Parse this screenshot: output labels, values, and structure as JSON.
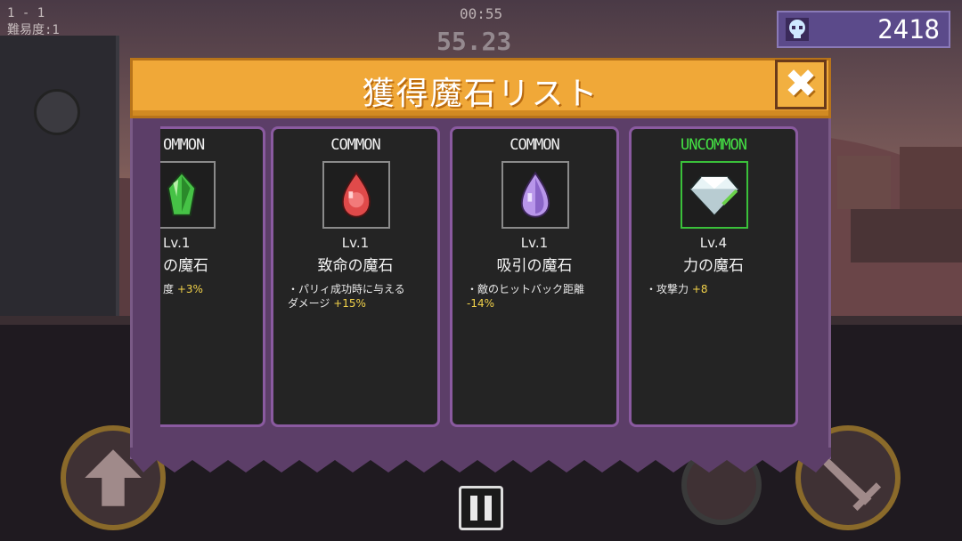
{
  "hud": {
    "stage": "1 - 1",
    "difficulty": "難易度:1",
    "timer": "00:55",
    "timer_large": "55.23",
    "currency_amount": "2418"
  },
  "dialog": {
    "title": "獲得魔石リスト",
    "cards": [
      {
        "rarity": "COMMON",
        "rarity_visible": "OMMON",
        "level": "Lv.1",
        "name_visible": "の魔石",
        "effect_visible": "度",
        "effect_value": "+3%",
        "gem": "green-gem-icon",
        "color": "#3cb83c"
      },
      {
        "rarity": "COMMON",
        "level": "Lv.1",
        "name": "致命の魔石",
        "effect": "・パリィ成功時に与える\nダメージ",
        "effect_value": "+15%",
        "gem": "red-gem-icon",
        "color": "#e04040"
      },
      {
        "rarity": "COMMON",
        "level": "Lv.1",
        "name": "吸引の魔石",
        "effect": "・敵のヒットバック距離",
        "effect_value": "-14%",
        "gem": "purple-gem-icon",
        "color": "#b08ae0"
      },
      {
        "rarity": "UNCOMMON",
        "level": "Lv.4",
        "name": "力の魔石",
        "effect": "・攻撃力",
        "effect_value": "+8",
        "gem": "white-diamond-icon",
        "color": "#e8f0f0"
      }
    ]
  },
  "colors": {
    "banner": "#f0a838",
    "panel": "#5c3e68",
    "card_border": "#8a5aa0",
    "uncommon": "#44e044",
    "value": "#f2d24a"
  }
}
